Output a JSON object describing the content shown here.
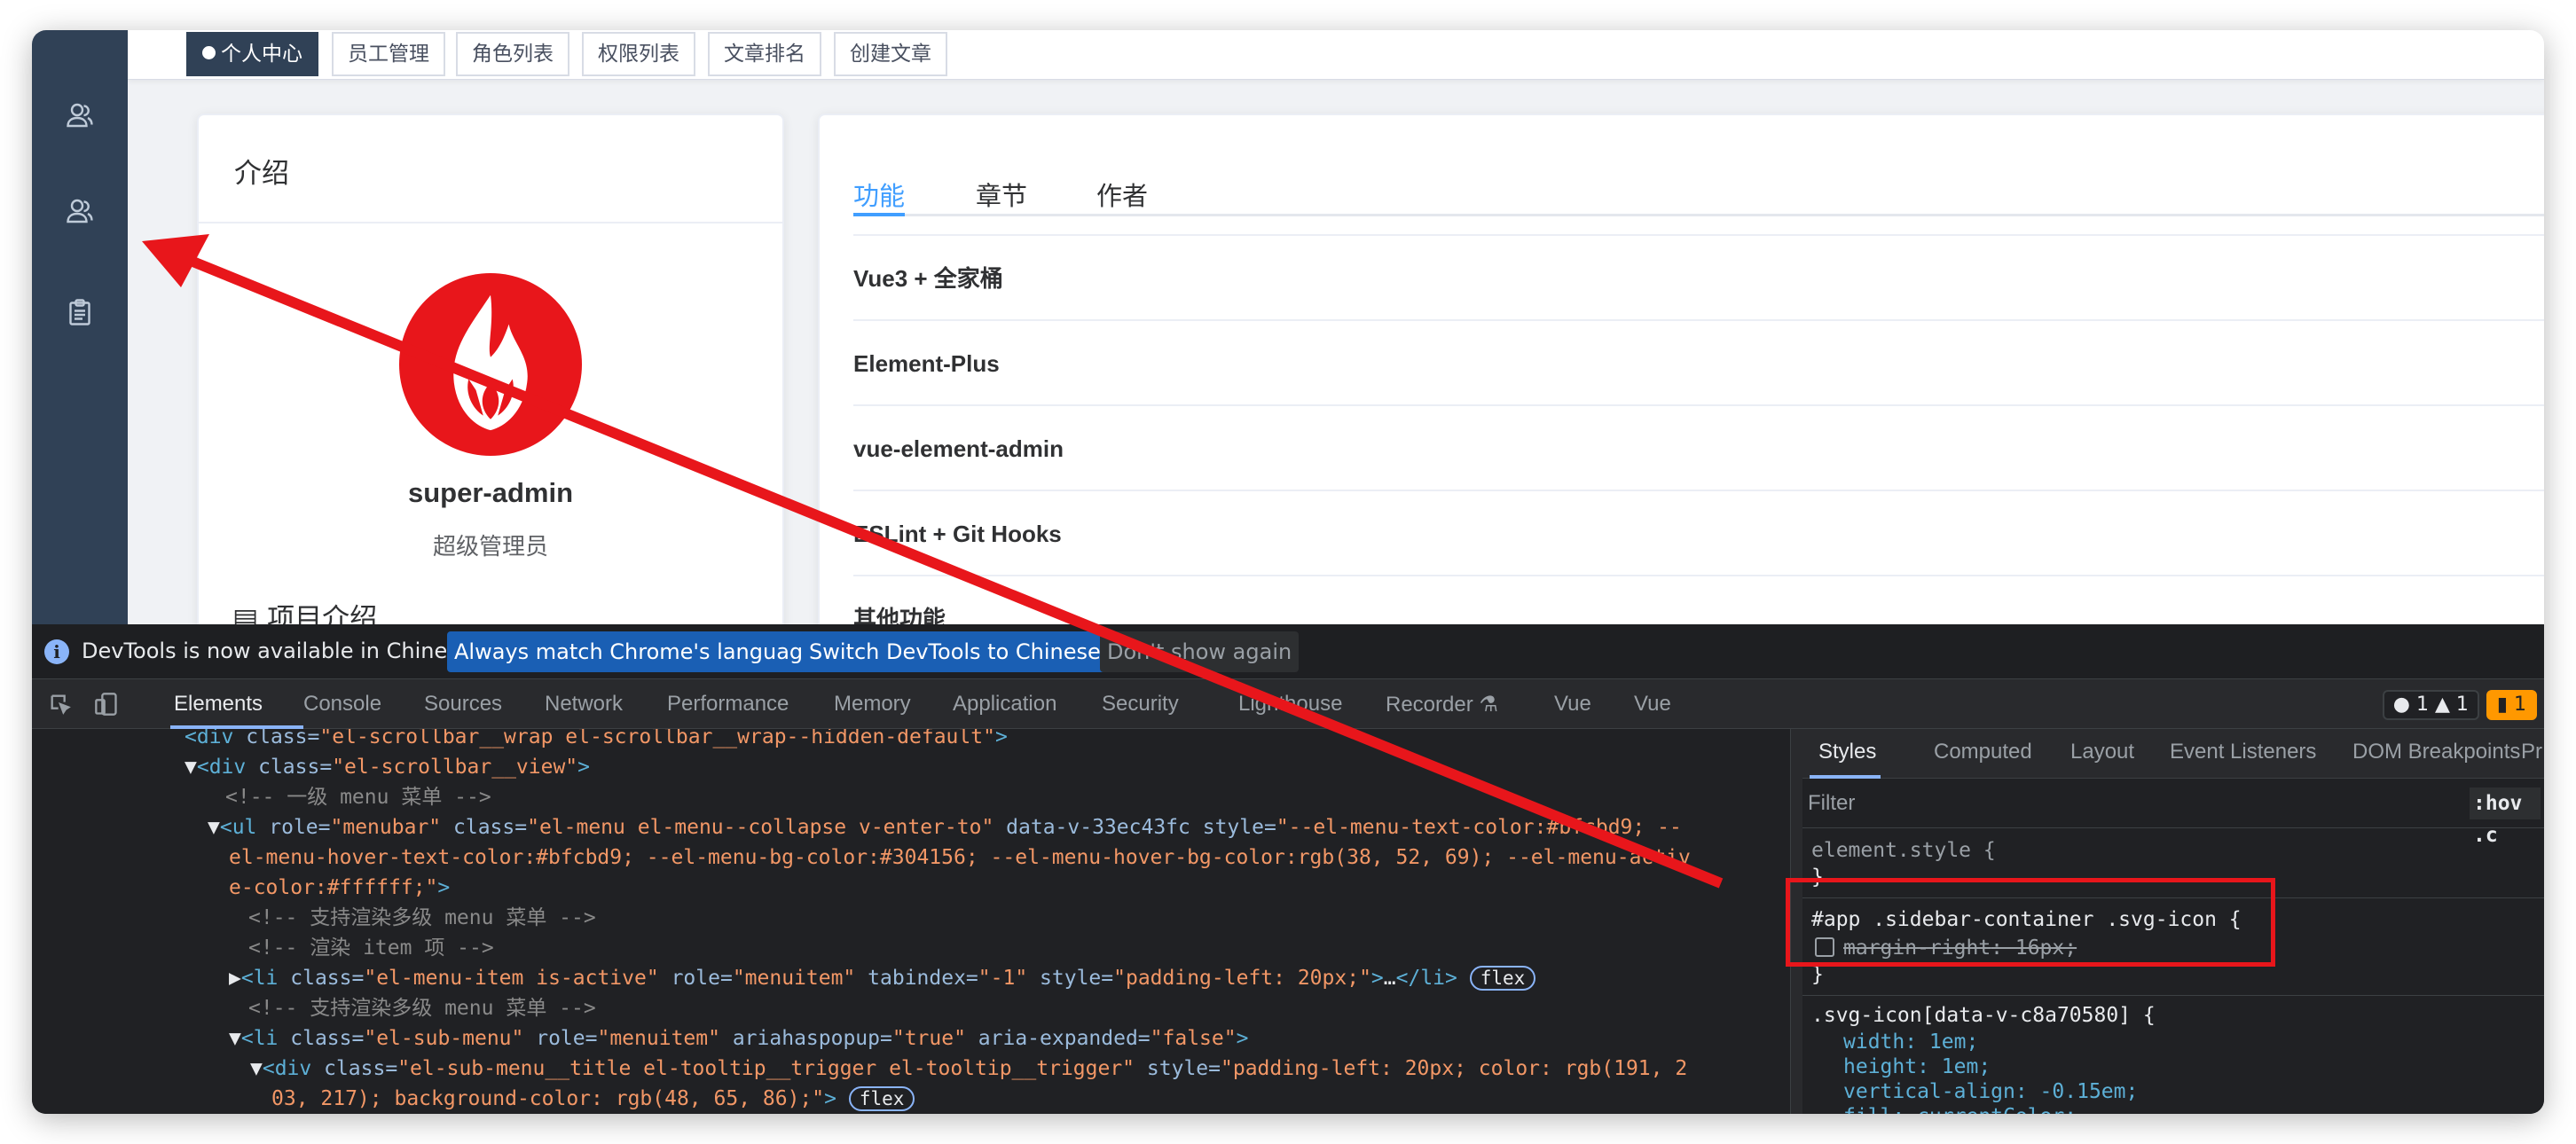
{
  "sidebar": {
    "icons": [
      "user-icon",
      "user-icon",
      "clipboard-icon"
    ]
  },
  "tags": [
    {
      "label": "个人中心",
      "active": true
    },
    {
      "label": "员工管理",
      "active": false
    },
    {
      "label": "角色列表",
      "active": false
    },
    {
      "label": "权限列表",
      "active": false
    },
    {
      "label": "文章排名",
      "active": false
    },
    {
      "label": "创建文章",
      "active": false
    }
  ],
  "profile": {
    "card_title": "介绍",
    "username": "super-admin",
    "role": "超级管理员",
    "section_title": "项目介绍"
  },
  "feature_tabs": [
    {
      "label": "功能",
      "active": true
    },
    {
      "label": "章节",
      "active": false
    },
    {
      "label": "作者",
      "active": false
    }
  ],
  "feature_items": [
    "Vue3 + 全家桶",
    "Element-Plus",
    "vue-element-admin",
    "ESLint + Git Hooks",
    "其他功能"
  ],
  "devtools": {
    "infobar": {
      "message": "DevTools is now available in Chinese!",
      "btn_match": "Always match Chrome's language",
      "btn_switch": "Switch DevTools to Chinese",
      "btn_dismiss": "Don't show again"
    },
    "tabs": [
      "Elements",
      "Console",
      "Sources",
      "Network",
      "Performance",
      "Memory",
      "Application",
      "Security",
      "Lighthouse",
      "Recorder",
      "Vue",
      "Vue"
    ],
    "active_tab": "Elements",
    "badges": {
      "errors": "1",
      "warnings": "1",
      "issues": "1"
    },
    "code_lines": [
      {
        "html": "<span class='c-tag'>&lt;div</span> <span class='c-attr'>class=</span><span class='c-val'>\"el-scrollbar__wrap el-scrollbar__wrap--hidden-default\"</span><span class='c-tag'>&gt;</span>"
      },
      {
        "html": "<span class='c-txt'>▼</span><span class='c-tag'>&lt;div</span> <span class='c-attr'>class=</span><span class='c-val'>\"el-scrollbar__view\"</span><span class='c-tag'>&gt;</span>"
      },
      {
        "html": "<span class='c-cmt'>&lt;!-- 一级 menu 菜单 --&gt;</span>"
      },
      {
        "html": "<span class='c-txt'>▼</span><span class='c-tag'>&lt;ul</span> <span class='c-attr'>role=</span><span class='c-val'>\"menubar\"</span> <span class='c-attr'>class=</span><span class='c-val'>\"el-menu el-menu--collapse v-enter-to\"</span> <span class='c-attr'>data-v-33ec43fc</span> <span class='c-attr'>style=</span><span class='c-val'>\"--el-menu-text-color:#bfcbd9; --</span>"
      },
      {
        "html": "<span class='c-val'>el-menu-hover-text-color:#bfcbd9; --el-menu-bg-color:#304156; --el-menu-hover-bg-color:rgb(38, 52, 69); --el-menu-activ</span>"
      },
      {
        "html": "<span class='c-val'>e-color:#ffffff;\"</span><span class='c-tag'>&gt;</span>"
      },
      {
        "html": "<span class='c-cmt'>&lt;!-- 支持渲染多级 menu 菜单 --&gt;</span>"
      },
      {
        "html": "<span class='c-cmt'>&lt;!-- 渲染 item 项 --&gt;</span>"
      },
      {
        "html": "<span class='c-txt'>▶</span><span class='c-tag'>&lt;li</span> <span class='c-attr'>class=</span><span class='c-val'>\"el-menu-item is-active\"</span> <span class='c-attr'>role=</span><span class='c-val'>\"menuitem\"</span> <span class='c-attr'>tabindex=</span><span class='c-val'>\"-1\"</span> <span class='c-attr'>style=</span><span class='c-val'>\"padding-left: 20px;\"</span><span class='c-tag'>&gt;</span><span class='c-txt'>…</span><span class='c-tag'>&lt;/li&gt;</span> <span class='flexbadge'>flex</span>"
      },
      {
        "html": "<span class='c-cmt'>&lt;!-- 支持渲染多级 menu 菜单 --&gt;</span>"
      },
      {
        "html": "<span class='c-txt'>▼</span><span class='c-tag'>&lt;li</span> <span class='c-attr'>class=</span><span class='c-val'>\"el-sub-menu\"</span> <span class='c-attr'>role=</span><span class='c-val'>\"menuitem\"</span> <span class='c-attr'>ariahaspopup=</span><span class='c-val'>\"true\"</span> <span class='c-attr'>aria-expanded=</span><span class='c-val'>\"false\"</span><span class='c-tag'>&gt;</span>"
      },
      {
        "html": "<span class='c-txt'>▼</span><span class='c-tag'>&lt;div</span> <span class='c-attr'>class=</span><span class='c-val'>\"el-sub-menu__title el-tooltip__trigger el-tooltip__trigger\"</span> <span class='c-attr'>style=</span><span class='c-val'>\"padding-left: 20px; color: rgb(191, 2</span>"
      },
      {
        "html": "<span class='c-val'>03, 217); background-color: rgb(48, 65, 86);\"</span><span class='c-tag'>&gt;</span> <span class='flexbadge'>flex</span>"
      }
    ],
    "styles_tabs": [
      "Styles",
      "Computed",
      "Layout",
      "Event Listeners",
      "DOM Breakpoints",
      "Pr"
    ],
    "filter_placeholder": "Filter",
    "hov_label": ":hov .c",
    "rules": {
      "element_style": "element.style {",
      "close": "}",
      "r1_selector": "#app .sidebar-container .svg-icon {",
      "r1_prop": "margin-right",
      "r1_val": ": 16px;",
      "r2_selector": ".svg-icon[data-v-c8a70580] {",
      "r2_decls": [
        "width: 1em;",
        "height: 1em;",
        "vertical-align: -0.15em;",
        "fill: currentColor;"
      ]
    }
  },
  "colors": {
    "sidebar": "#304156",
    "accent": "#409eff",
    "annotation_red": "#e8161b",
    "devtools_bg": "#202124"
  }
}
